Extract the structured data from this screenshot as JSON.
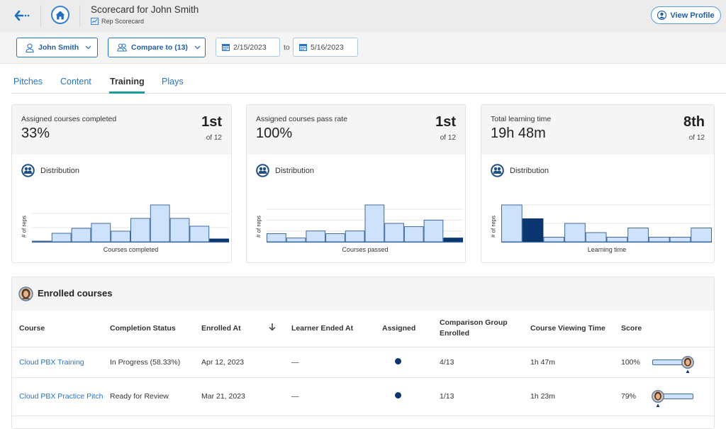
{
  "header": {
    "title": "Scorecard for John Smith",
    "subtitle": "Rep Scorecard",
    "view_profile_label": "View Profile",
    "back_icon": "back-arrow-icon",
    "home_icon": "home-icon"
  },
  "filters": {
    "rep_label": "John Smith",
    "compare_label": "Compare to (13)",
    "start_date": "2/15/2023",
    "to_label": "to",
    "end_date": "5/16/2023"
  },
  "tabs": [
    {
      "label": "Pitches",
      "active": false
    },
    {
      "label": "Content",
      "active": false
    },
    {
      "label": "Training",
      "active": true
    },
    {
      "label": "Plays",
      "active": false
    }
  ],
  "metrics": [
    {
      "title": "Assigned courses completed",
      "value": "33%",
      "rank": "1st",
      "rank_of": "of 12",
      "distribution_label": "Distribution"
    },
    {
      "title": "Assigned courses pass rate",
      "value": "100%",
      "rank": "1st",
      "rank_of": "of 12",
      "distribution_label": "Distribution"
    },
    {
      "title": "Total learning time",
      "value": "19h 48m",
      "rank": "8th",
      "rank_of": "of 12",
      "distribution_label": "Distribution"
    }
  ],
  "enrolled": {
    "title": "Enrolled courses",
    "columns": [
      "Course",
      "Completion Status",
      "Enrolled At",
      "Learner Ended At",
      "Assigned",
      "Comparison Group Enrolled",
      "Course Viewing Time",
      "Score"
    ],
    "sort_column": "Enrolled At",
    "sort_direction": "descending",
    "rows": [
      {
        "course": "Cloud PBX Training",
        "status": "In Progress (58.33%)",
        "enrolled_at": "Apr 12, 2023",
        "learner_ended_at": "—",
        "assigned": true,
        "comparison_group_enrolled": "4/13",
        "course_viewing_time": "1h 47m",
        "score": "100%",
        "score_marker_position": 1.0
      },
      {
        "course": "Cloud PBX Practice Pitch",
        "status": "Ready for Review",
        "enrolled_at": "Mar 21, 2023",
        "learner_ended_at": "—",
        "assigned": true,
        "comparison_group_enrolled": "1/13",
        "course_viewing_time": "1h 23m",
        "score": "79%",
        "score_marker_position": 0.0
      }
    ]
  },
  "colors": {
    "accent": "#2a74c2",
    "tab_underline": "#1d9b9b",
    "bar_fill": "#cfe2fb",
    "bar_border": "#3f6b9c",
    "bar_highlight": "#0c3670",
    "header_bg": "#ececec"
  },
  "chart_data": [
    {
      "type": "bar",
      "title": "Distribution",
      "xlabel": "Courses completed",
      "ylabel": "# of reps",
      "values": [
        0.05,
        0.6,
        0.95,
        1.3,
        0.75,
        1.65,
        2.6,
        1.65,
        1.1,
        0.2
      ],
      "highlight_index": 9,
      "gridlines": [
        1,
        2
      ],
      "ylim": [
        0,
        2.6
      ],
      "grid": true
    },
    {
      "type": "bar",
      "title": "Distribution",
      "xlabel": "Courses passed",
      "ylabel": "# of reps",
      "values": [
        0.75,
        0.35,
        1.0,
        0.75,
        1.0,
        3.4,
        1.7,
        1.4,
        2.0,
        0.35
      ],
      "highlight_index": 9,
      "gridlines": [
        1,
        2,
        3
      ],
      "ylim": [
        0,
        3.4
      ],
      "grid": true
    },
    {
      "type": "bar",
      "title": "Distribution",
      "xlabel": "Learning time",
      "ylabel": "# of reps",
      "values": [
        2.0,
        1.25,
        0.25,
        1.0,
        0.5,
        0.25,
        0.75,
        0.25,
        0.25,
        0.75
      ],
      "highlight_index": 1,
      "gridlines": [
        1,
        2
      ],
      "ylim": [
        0,
        2.0
      ],
      "grid": true
    }
  ]
}
